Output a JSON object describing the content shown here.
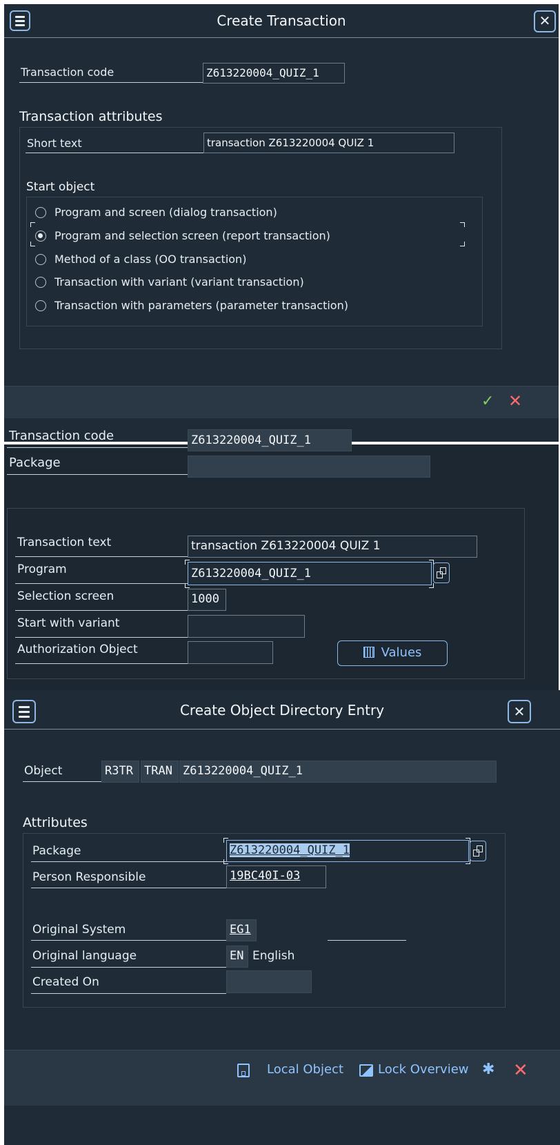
{
  "dialog1": {
    "title": "Create Transaction",
    "tcode_label": "Transaction code",
    "tcode_value": "Z613220004_QUIZ_1",
    "attributes_heading": "Transaction attributes",
    "short_text_label": "Short text",
    "short_text_value": "transaction Z613220004 QUIZ 1",
    "start_object_heading": "Start object",
    "options": [
      "Program and screen (dialog transaction)",
      "Program and selection screen (report transaction)",
      "Method of a class (OO transaction)",
      "Transaction with variant (variant transaction)",
      "Transaction with parameters (parameter transaction)"
    ],
    "selected_index": 1
  },
  "screen2": {
    "tcode_label": "Transaction code",
    "tcode_value": "Z613220004_QUIZ_1",
    "package_label": "Package",
    "package_value": "",
    "trans_text_label": "Transaction text",
    "trans_text_value": "transaction Z613220004 QUIZ 1",
    "program_label": "Program",
    "program_value": "Z613220004_QUIZ_1",
    "selscreen_label": "Selection screen",
    "selscreen_value": "1000",
    "variant_label": "Start with variant",
    "variant_value": "",
    "auth_label": "Authorization Object",
    "auth_value": "",
    "values_button": "Values"
  },
  "dialog3": {
    "title": "Create Object Directory Entry",
    "object_label": "Object",
    "object_pgmid": "R3TR",
    "object_type": "TRAN",
    "object_name": "Z613220004_QUIZ_1",
    "attributes_heading": "Attributes",
    "package_label": "Package",
    "package_value": "Z613220004_QUIZ_1",
    "person_label": "Person Responsible",
    "person_value": "19BC40I-03",
    "orig_system_label": "Original System",
    "orig_system_value": "EG1",
    "orig_lang_label": "Original language",
    "orig_lang_value": "EN",
    "orig_lang_text": "English",
    "created_label": "Created On",
    "created_value": "",
    "local_object_button": "Local Object",
    "lock_overview_button": "Lock Overview"
  },
  "colors": {
    "panel_bg": "#1f2b36",
    "footer_bg": "#2a3845",
    "accent_blue": "#8fc3ff",
    "ok_green": "#7ed163",
    "cancel_red": "#ff6b6b"
  }
}
